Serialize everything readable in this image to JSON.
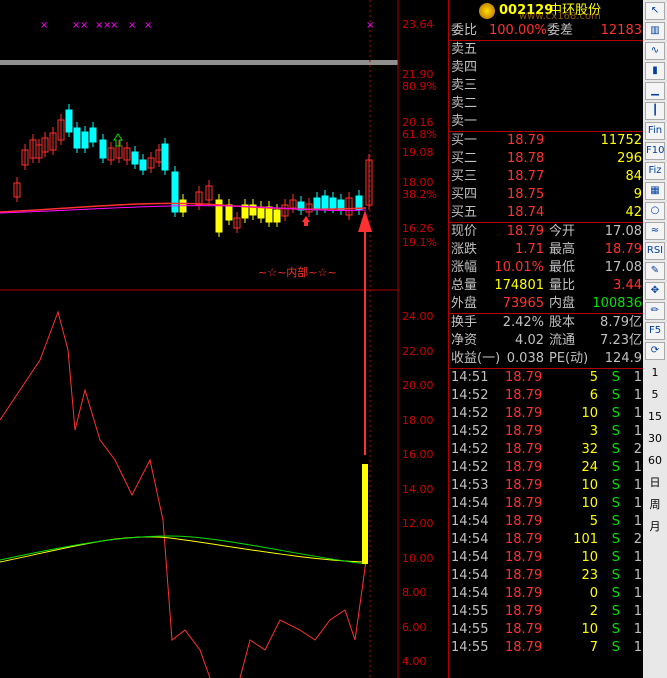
{
  "stock": {
    "code": "002129",
    "name": "中环股份",
    "watermark": "www.cx168.com"
  },
  "chart": {
    "upper_axis": [
      "23.64",
      "21.90",
      "80.9%",
      "20.16",
      "61.8%",
      "19.08",
      "18.00",
      "38.2%",
      "16.26",
      "19.1%"
    ],
    "lower_axis": [
      "24.00",
      "22.00",
      "20.00",
      "18.00",
      "16.00",
      "14.00",
      "12.00",
      "10.00",
      "8.00",
      "6.00",
      "4.00"
    ],
    "annotation": "~☆~内部~☆~",
    "markers": [
      "×",
      "×",
      "×",
      "×",
      "×",
      "×",
      "×",
      "×",
      "×"
    ],
    "colors": {
      "up": "#ff3030",
      "down": "#00ffff",
      "yellow": "#ffff00",
      "magenta": "#ff00ff",
      "green": "#00e000"
    }
  },
  "quote": {
    "weibi_label": "委比",
    "weibi_value": "100.00%",
    "weicha_label": "委差",
    "weicha_value": "12183",
    "sell": [
      {
        "label": "卖五"
      },
      {
        "label": "卖四"
      },
      {
        "label": "卖三"
      },
      {
        "label": "卖二"
      },
      {
        "label": "卖一"
      }
    ],
    "buy": [
      {
        "label": "买一",
        "price": "18.79",
        "vol": "11752"
      },
      {
        "label": "买二",
        "price": "18.78",
        "vol": "296"
      },
      {
        "label": "买三",
        "price": "18.77",
        "vol": "84"
      },
      {
        "label": "买四",
        "price": "18.75",
        "vol": "9"
      },
      {
        "label": "买五",
        "price": "18.74",
        "vol": "42"
      }
    ],
    "stats": [
      {
        "l1": "现价",
        "v1": "18.79",
        "l2": "今开",
        "v2": "17.08"
      },
      {
        "l1": "涨跌",
        "v1": "1.71",
        "l2": "最高",
        "v2": "18.79"
      },
      {
        "l1": "涨幅",
        "v1": "10.01%",
        "l2": "最低",
        "v2": "17.08"
      },
      {
        "l1": "总量",
        "v1": "174801",
        "l2": "量比",
        "v2": "3.44"
      },
      {
        "l1": "外盘",
        "v1": "73965",
        "l2": "内盘",
        "v2": "100836"
      }
    ],
    "extra": [
      {
        "l1": "换手",
        "v1": "2.42%",
        "l2": "股本",
        "v2": "8.79亿"
      },
      {
        "l1": "净资",
        "v1": "4.02",
        "l2": "流通",
        "v2": "7.23亿"
      },
      {
        "l1": "收益(一)",
        "v1": "0.038",
        "l2": "PE(动)",
        "v2": "124.9"
      }
    ]
  },
  "ticks": [
    {
      "t": "14:51",
      "p": "18.79",
      "v": "5",
      "n": "1",
      "s": "S"
    },
    {
      "t": "14:52",
      "p": "18.79",
      "v": "6",
      "n": "1",
      "s": "S"
    },
    {
      "t": "14:52",
      "p": "18.79",
      "v": "10",
      "n": "1",
      "s": "S"
    },
    {
      "t": "14:52",
      "p": "18.79",
      "v": "3",
      "n": "1",
      "s": "S"
    },
    {
      "t": "14:52",
      "p": "18.79",
      "v": "32",
      "n": "2",
      "s": "S"
    },
    {
      "t": "14:52",
      "p": "18.79",
      "v": "24",
      "n": "1",
      "s": "S"
    },
    {
      "t": "14:53",
      "p": "18.79",
      "v": "10",
      "n": "1",
      "s": "S"
    },
    {
      "t": "14:54",
      "p": "18.79",
      "v": "10",
      "n": "1",
      "s": "S"
    },
    {
      "t": "14:54",
      "p": "18.79",
      "v": "5",
      "n": "1",
      "s": "S"
    },
    {
      "t": "14:54",
      "p": "18.79",
      "v": "101",
      "n": "2",
      "s": "S"
    },
    {
      "t": "14:54",
      "p": "18.79",
      "v": "10",
      "n": "1",
      "s": "S"
    },
    {
      "t": "14:54",
      "p": "18.79",
      "v": "23",
      "n": "1",
      "s": "S"
    },
    {
      "t": "14:54",
      "p": "18.79",
      "v": "0",
      "n": "1",
      "s": "S"
    },
    {
      "t": "14:55",
      "p": "18.79",
      "v": "2",
      "n": "1",
      "s": "S"
    },
    {
      "t": "14:55",
      "p": "18.79",
      "v": "10",
      "n": "1",
      "s": "S"
    },
    {
      "t": "14:55",
      "p": "18.79",
      "v": "7",
      "n": "1",
      "s": "S"
    }
  ],
  "toolbar": {
    "icons": [
      "arrow-icon",
      "chart-icon",
      "line-icon",
      "candle-icon",
      "volume-icon",
      "kline-icon",
      "fin-icon",
      "f10-icon",
      "fiz-icon",
      "grid-icon",
      "circle-icon",
      "wave-icon",
      "rsi-icon",
      "wrench-icon",
      "move-icon",
      "pen-icon",
      "f5-icon",
      "refresh-icon"
    ],
    "periods": [
      "1",
      "5",
      "15",
      "30",
      "60",
      "日",
      "周",
      "月"
    ]
  }
}
